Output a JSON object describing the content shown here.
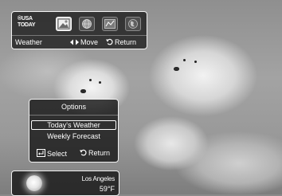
{
  "top_bar": {
    "logo_line1": "®USA",
    "logo_line2": "TODAY",
    "title": "Weather",
    "move_hint": "Move",
    "return_hint": "Return"
  },
  "options": {
    "title": "Options",
    "items": [
      "Today's Weather",
      "Weekly Forecast"
    ],
    "selected_index": 0,
    "select_hint": "Select",
    "return_hint": "Return"
  },
  "weather": {
    "city": "Los Angeles",
    "temperature": "59°F",
    "condition_icon": "sun-icon"
  },
  "icons": [
    "photo-icon",
    "globe-icon",
    "map-icon",
    "earth-icon"
  ],
  "colors": {
    "panel_bg": "#191919",
    "panel_border": "#f2f2f2",
    "text": "#ffffff"
  }
}
